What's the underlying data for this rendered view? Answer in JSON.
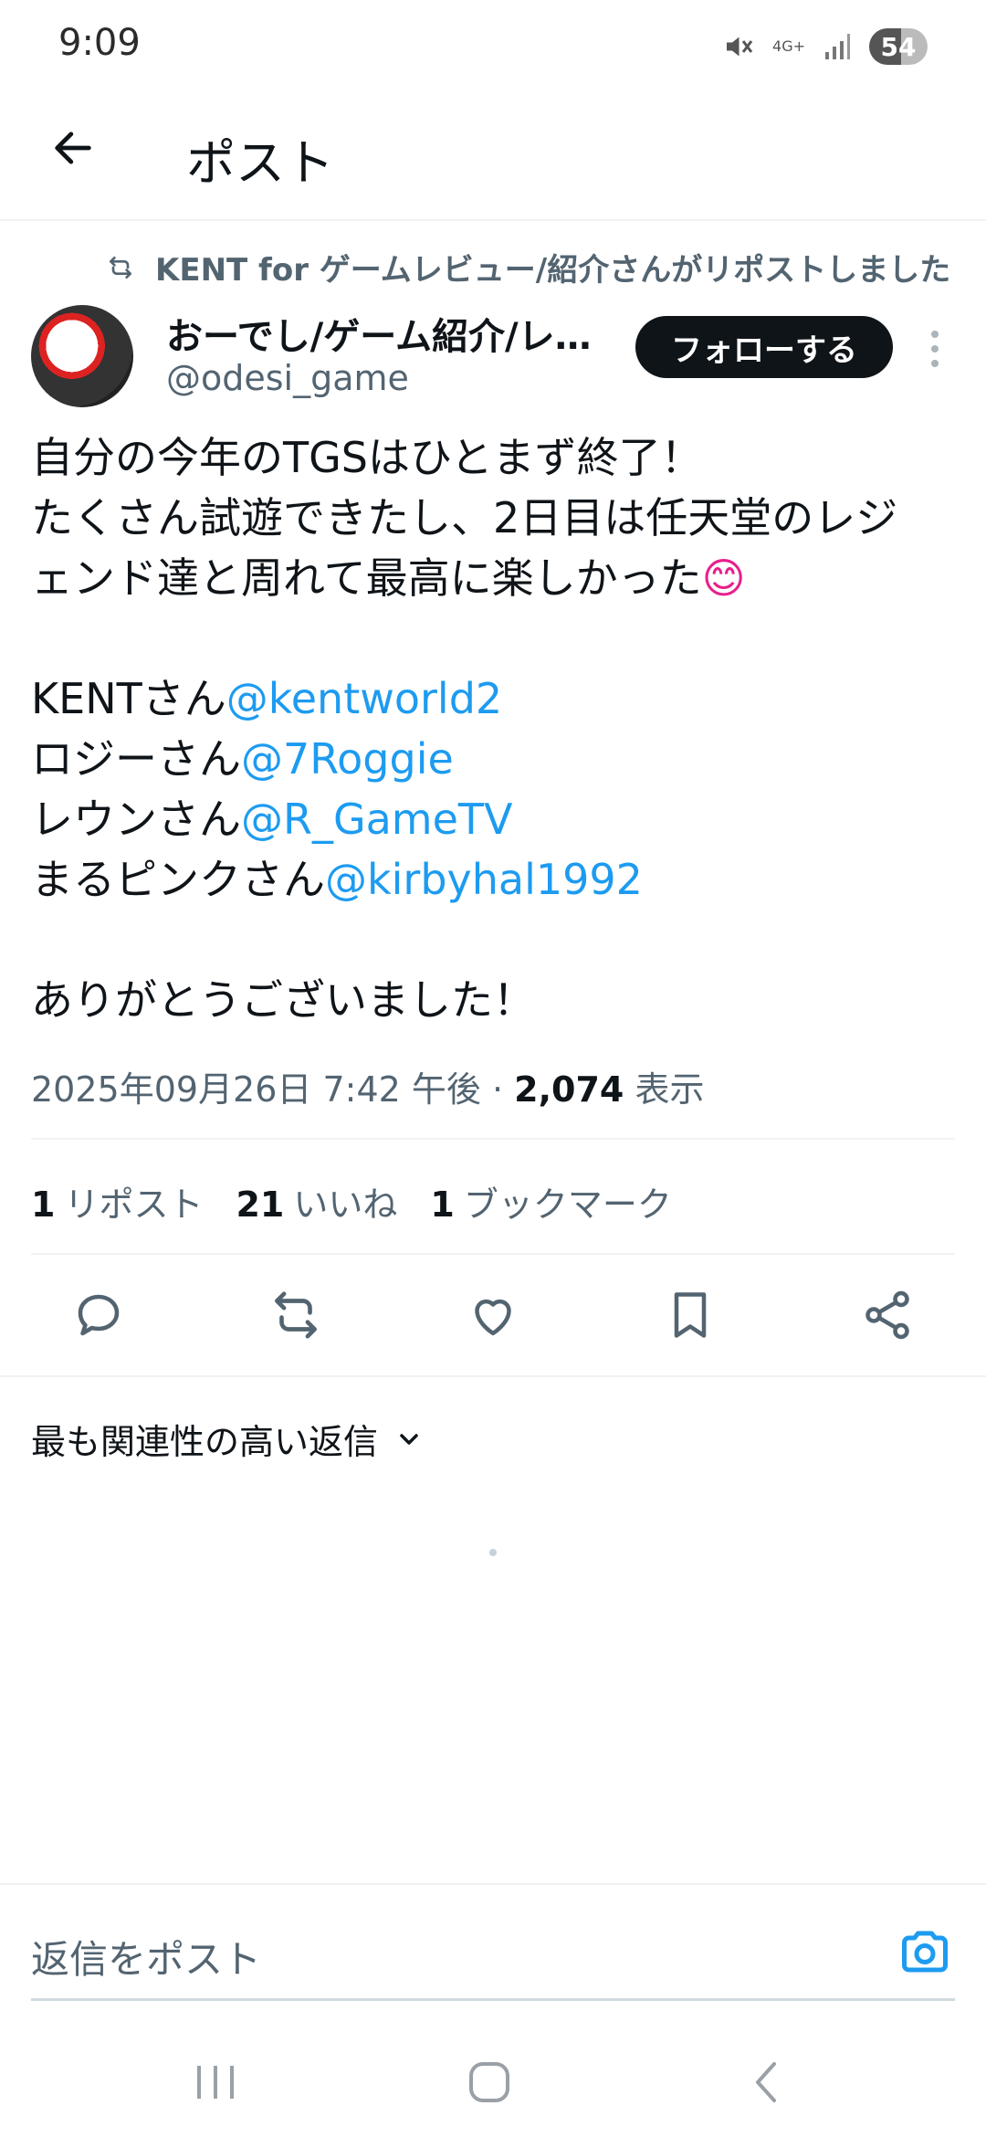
{
  "status_bar": {
    "time": "9:09",
    "network": "4G+",
    "battery": "54"
  },
  "header": {
    "title": "ポスト"
  },
  "post": {
    "repost_label": "KENT for ゲームレビュー/紹介さんがリポストしました",
    "author_name": "おーでし/ゲーム紹介/レ…",
    "author_handle": "@odesi_game",
    "follow_label": "フォローする",
    "body": {
      "line1": "自分の今年のTGSはひとまず終了！",
      "line2": "たくさん試遊できたし、2日目は任天堂のレジ",
      "line3": "ェンド達と周れて最高に楽しかった",
      "line3_emoji": "😊",
      "mentions": [
        {
          "prefix": "KENTさん",
          "handle": "@kentworld2"
        },
        {
          "prefix": "ロジーさん",
          "handle": "@7Roggie"
        },
        {
          "prefix": "レウンさん",
          "handle": "@R_GameTV"
        },
        {
          "prefix": "まるピンクさん",
          "handle": "@kirbyhal1992"
        }
      ],
      "closing": "ありがとうございました！"
    },
    "timestamp": "2025年09月26日 7:42 午後",
    "separator": " · ",
    "views_count": "2,074",
    "views_label": "表示"
  },
  "stats": {
    "reposts_count": "1",
    "reposts_label": "リポスト",
    "likes_count": "21",
    "likes_label": "いいね",
    "bookmarks_count": "1",
    "bookmarks_label": "ブックマーク"
  },
  "replies": {
    "sort_label": "最も関連性の高い返信"
  },
  "reply_bar": {
    "placeholder": "返信をポスト"
  },
  "colors": {
    "accent": "#1d9bf0",
    "text": "#0f1419",
    "secondary": "#536471"
  }
}
